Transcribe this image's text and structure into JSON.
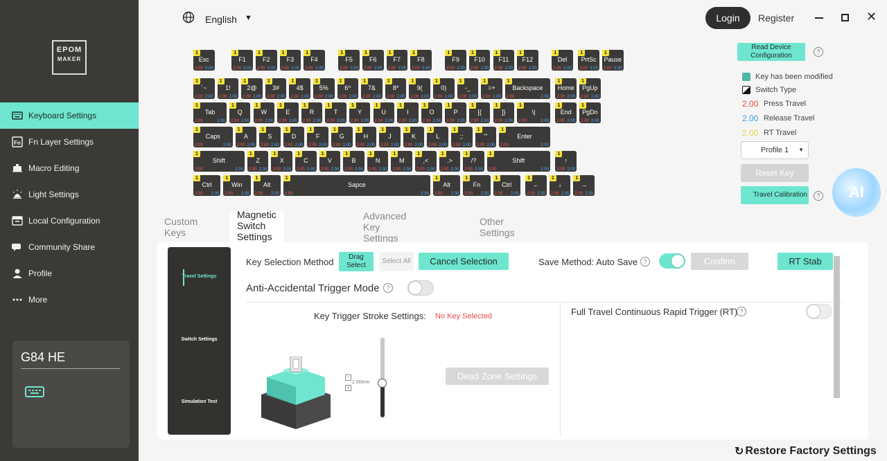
{
  "app": {
    "logo_line1": "EPOM",
    "logo_line2": "MAKER"
  },
  "sidebar": {
    "items": [
      {
        "label": "Keyboard Settings",
        "icon": "keyboard-icon",
        "active": true
      },
      {
        "label": "Fn Layer Settings",
        "icon": "fn-icon",
        "active": false
      },
      {
        "label": "Macro Editing",
        "icon": "macro-icon",
        "active": false
      },
      {
        "label": "Light Settings",
        "icon": "light-icon",
        "active": false
      },
      {
        "label": "Local Configuration",
        "icon": "folder-icon",
        "active": false
      },
      {
        "label": "Community Share",
        "icon": "chat-icon",
        "active": false
      },
      {
        "label": "Profile",
        "icon": "user-icon",
        "active": false
      },
      {
        "label": "More",
        "icon": "more-icon",
        "active": false
      }
    ],
    "device_name": "G84 HE"
  },
  "topbar": {
    "language": "English",
    "login": "Login",
    "register": "Register"
  },
  "keyboard": {
    "layer_tag": "1",
    "press_default": "2.00",
    "release_default": "2.00",
    "rows": [
      [
        [
          "Esc",
          1
        ],
        [
          "",
          0.6
        ],
        [
          "F1",
          1
        ],
        [
          "F2",
          1
        ],
        [
          "F3",
          1
        ],
        [
          "F4",
          1
        ],
        [
          "",
          0.45
        ],
        [
          "F5",
          1
        ],
        [
          "F6",
          1
        ],
        [
          "F7",
          1
        ],
        [
          "F8",
          1
        ],
        [
          "",
          0.45
        ],
        [
          "F9",
          1
        ],
        [
          "F10",
          1
        ],
        [
          "F11",
          1
        ],
        [
          "F12",
          1
        ],
        [
          "",
          0.45
        ],
        [
          "Del",
          1
        ],
        [
          "",
          0.1
        ],
        [
          "PrtSc",
          1
        ],
        [
          "Pause",
          1
        ]
      ],
      [
        [
          "`~",
          1
        ],
        [
          "1!",
          1
        ],
        [
          "2@",
          1
        ],
        [
          "3#",
          1
        ],
        [
          "4$",
          1
        ],
        [
          "5%",
          1
        ],
        [
          "6^",
          1
        ],
        [
          "7&",
          1
        ],
        [
          "8*",
          1
        ],
        [
          "9(",
          1
        ],
        [
          "0)",
          1
        ],
        [
          "-_",
          1
        ],
        [
          "=+",
          1
        ],
        [
          "Backspace",
          2
        ],
        [
          "",
          0.1
        ],
        [
          "Home",
          1
        ],
        [
          "PgUp",
          1
        ]
      ],
      [
        [
          "Tab",
          1.5
        ],
        [
          "Q",
          1
        ],
        [
          "W",
          1
        ],
        [
          "E",
          1
        ],
        [
          "R",
          1
        ],
        [
          "T",
          1
        ],
        [
          "Y",
          1
        ],
        [
          "U",
          1
        ],
        [
          "I",
          1
        ],
        [
          "O",
          1
        ],
        [
          "P",
          1
        ],
        [
          "[{",
          1
        ],
        [
          "]}",
          1
        ],
        [
          "\\|",
          1.5
        ],
        [
          "",
          0.1
        ],
        [
          "End",
          1
        ],
        [
          "PgDn",
          1
        ]
      ],
      [
        [
          "Caps",
          1.75
        ],
        [
          "A",
          1
        ],
        [
          "S",
          1
        ],
        [
          "D",
          1
        ],
        [
          "F",
          1
        ],
        [
          "G",
          1
        ],
        [
          "H",
          1
        ],
        [
          "J",
          1
        ],
        [
          "K",
          1
        ],
        [
          "L",
          1
        ],
        [
          ";:",
          1
        ],
        [
          "'\"",
          1
        ],
        [
          "Enter",
          2.25
        ]
      ],
      [
        [
          "Shift",
          2.25
        ],
        [
          "Z",
          1
        ],
        [
          "X",
          1
        ],
        [
          "C",
          1
        ],
        [
          "V",
          1
        ],
        [
          "B",
          1
        ],
        [
          "N",
          1
        ],
        [
          "M",
          1
        ],
        [
          ",<",
          1
        ],
        [
          ".>",
          1
        ],
        [
          "/?",
          1
        ],
        [
          "Shift",
          2.75
        ],
        [
          "",
          0.1
        ],
        [
          "↑",
          1
        ]
      ],
      [
        [
          "Ctrl",
          1.25
        ],
        [
          "Win",
          1.25
        ],
        [
          "Alt",
          1.25
        ],
        [
          "Sapce",
          6.25
        ],
        [
          "Alt",
          1.25
        ],
        [
          "Fn",
          1.25
        ],
        [
          "Ctrl",
          1.25
        ],
        [
          "",
          0.1
        ],
        [
          "←",
          1
        ],
        [
          "↓",
          1
        ],
        [
          "→",
          1
        ]
      ]
    ]
  },
  "legend": {
    "read_device": "Read Device Configuration",
    "key_modified": "Key has been modified",
    "switch_type": "Switch Type",
    "press_travel_value": "2.00",
    "press_travel": "Press Travel",
    "release_travel_value": "2.00",
    "release_travel": "Release Travel",
    "rt_travel_value": "2.00",
    "rt_travel": "RT Travel",
    "profile": "Profile 1",
    "reset_key": "Reset Key",
    "travel_calibration": "Travel Calibration",
    "ai": "AI",
    "colors": {
      "modified": "#4fb7a4",
      "press": "#e94b4b",
      "release": "#3aa0e6",
      "rt": "#e6d44a"
    }
  },
  "tabs": [
    {
      "label": "Custom Keys",
      "active": false
    },
    {
      "label": "Magnetic Switch Settings",
      "active": true
    },
    {
      "label": "Advanced Key Settings",
      "active": false
    },
    {
      "label": "Other Settings",
      "active": false
    }
  ],
  "panel": {
    "side_menu": [
      "Travel Settings",
      "Switch Settings",
      "Simulation Test"
    ],
    "key_selection_method": "Key Selection Method",
    "drag_select": "Drag Select",
    "select_all": "Select All",
    "cancel_selection": "Cancel Selection",
    "save_method": "Save Method: Auto Save",
    "confirm": "Confirm",
    "rt_stab": "RT Stab",
    "anti_accidental": "Anti-Accidental Trigger Mode",
    "key_trigger": "Key Trigger Stroke Settings:",
    "no_key_selected": "No Key Selected",
    "slider_value": "2.00mm",
    "dead_zone": "Dead Zone Settings",
    "full_travel": "Full Travel Continuous Rapid Trigger (RT)"
  },
  "footer": {
    "restore": "Restore Factory Settings"
  }
}
